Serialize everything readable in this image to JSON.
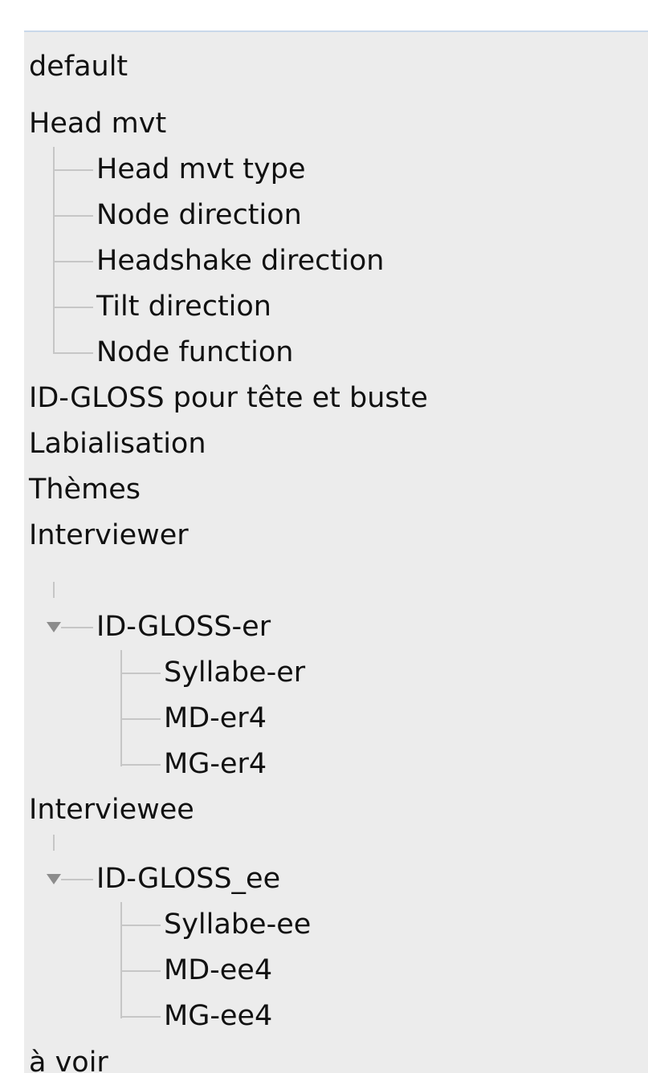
{
  "tree": {
    "items": [
      {
        "label": "default"
      },
      {
        "label": "Head mvt"
      },
      {
        "label": "Head mvt type"
      },
      {
        "label": "Node direction"
      },
      {
        "label": "Headshake direction"
      },
      {
        "label": "Tilt direction"
      },
      {
        "label": "Node function"
      },
      {
        "label": "ID-GLOSS pour tête et buste"
      },
      {
        "label": "Labialisation"
      },
      {
        "label": "Thèmes"
      },
      {
        "label": "Interviewer"
      },
      {
        "label": "ID-GLOSS-er",
        "expanded": true
      },
      {
        "label": "Syllabe-er"
      },
      {
        "label": "MD-er4"
      },
      {
        "label": "MG-er4"
      },
      {
        "label": "Interviewee"
      },
      {
        "label": "ID-GLOSS_ee",
        "expanded": true
      },
      {
        "label": "Syllabe-ee"
      },
      {
        "label": "MD-ee4"
      },
      {
        "label": "MG-ee4"
      },
      {
        "label": "à voir"
      }
    ]
  }
}
